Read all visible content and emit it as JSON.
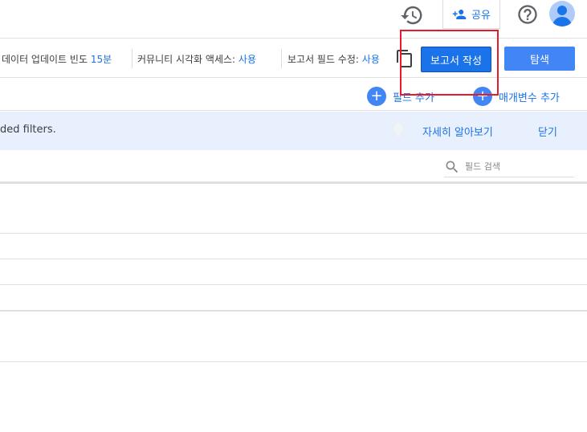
{
  "header": {
    "share_label": "공유"
  },
  "settings": {
    "data_freshness_label": "데이터 업데이트 빈도",
    "data_freshness_value": "15분",
    "community_viz_label": "커뮤니티 시각화 액세스:",
    "community_viz_value": "사용",
    "report_field_edit_label": "보고서 필드 수정:",
    "report_field_edit_value": "사용",
    "create_report_label": "보고서 작성",
    "explore_label": "탐색"
  },
  "field_toolbar": {
    "add_field_label": "필드 추가",
    "add_parameter_label": "매개변수 추가"
  },
  "banner": {
    "text": "ded filters.",
    "learn_more_label": "자세히 알아보기",
    "close_label": "닫기"
  },
  "search": {
    "placeholder": "필드 검색"
  },
  "colors": {
    "accent": "#1a73e8",
    "highlight": "#e8192c",
    "banner_bg": "#e8f0fe"
  },
  "icons": [
    "history-icon",
    "person-add-icon",
    "help-icon",
    "avatar-icon",
    "copy-icon",
    "plus-icon",
    "lightbulb-icon",
    "search-icon"
  ]
}
